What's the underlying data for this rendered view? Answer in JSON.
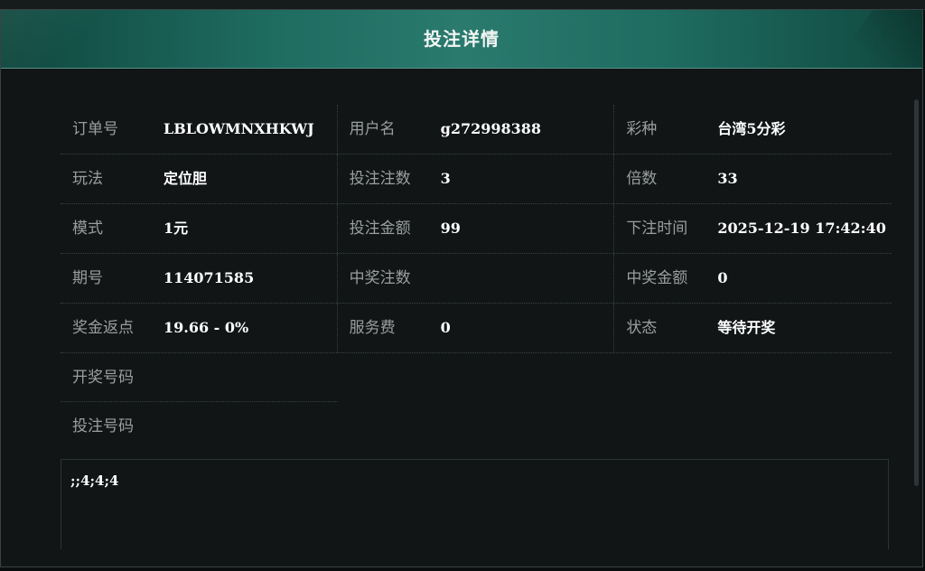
{
  "dialog": {
    "title": "投注详情"
  },
  "details": {
    "order_no": {
      "label": "订单号",
      "value": "LBLOWMNXHKWJ"
    },
    "username": {
      "label": "用户名",
      "value": "g272998388"
    },
    "lottery": {
      "label": "彩种",
      "value": "台湾5分彩"
    },
    "play": {
      "label": "玩法",
      "value": "定位胆"
    },
    "bet_count": {
      "label": "投注注数",
      "value": "3"
    },
    "multiple": {
      "label": "倍数",
      "value": "33"
    },
    "mode": {
      "label": "模式",
      "value": "1元"
    },
    "bet_amount": {
      "label": "投注金额",
      "value": "99"
    },
    "bet_time": {
      "label": "下注时间",
      "value": "2025-12-19 17:42:40"
    },
    "issue": {
      "label": "期号",
      "value": "114071585"
    },
    "win_count": {
      "label": "中奖注数",
      "value": ""
    },
    "win_amount": {
      "label": "中奖金额",
      "value": "0"
    },
    "rebate": {
      "label": "奖金返点",
      "value": "19.66 - 0%"
    },
    "service_fee": {
      "label": "服务费",
      "value": "0"
    },
    "status": {
      "label": "状态",
      "value": "等待开奖"
    },
    "draw_numbers": {
      "label": "开奖号码",
      "value": ""
    },
    "bet_numbers": {
      "label": "投注号码",
      "value": ";;4;4;4"
    }
  }
}
